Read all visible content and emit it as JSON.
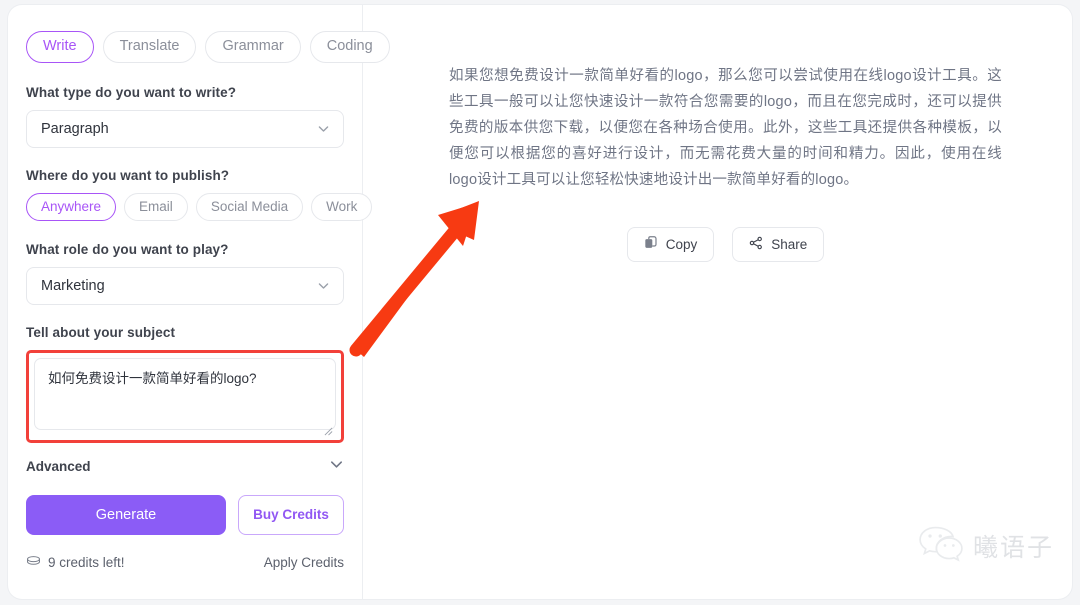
{
  "left": {
    "tabs": [
      {
        "label": "Write",
        "active": true
      },
      {
        "label": "Translate",
        "active": false
      },
      {
        "label": "Grammar",
        "active": false
      },
      {
        "label": "Coding",
        "active": false
      }
    ],
    "type_label": "What type do you want to write?",
    "type_value": "Paragraph",
    "publish_label": "Where do you want to publish?",
    "publish_options": [
      {
        "label": "Anywhere",
        "active": true
      },
      {
        "label": "Email",
        "active": false
      },
      {
        "label": "Social Media",
        "active": false
      },
      {
        "label": "Work",
        "active": false
      }
    ],
    "role_label": "What role do you want to play?",
    "role_value": "Marketing",
    "subject_label": "Tell about your subject",
    "subject_value": "如何免费设计一款简单好看的logo?",
    "subject_placeholder": "Tell about your subject",
    "advanced_label": "Advanced",
    "generate_label": "Generate",
    "buy_credits_label": "Buy Credits",
    "credits_left_label": "9 credits left!",
    "apply_credits_label": "Apply Credits"
  },
  "right": {
    "result_text": "如果您想免费设计一款简单好看的logo，那么您可以尝试使用在线logo设计工具。这些工具一般可以让您快速设计一款符合您需要的logo，而且在您完成时，还可以提供免费的版本供您下载，以便您在各种场合使用。此外，这些工具还提供各种模板，以便您可以根据您的喜好进行设计，而无需花费大量的时间和精力。因此，使用在线logo设计工具可以让您轻松快速地设计出一款简单好看的logo。",
    "copy_label": "Copy",
    "share_label": "Share"
  },
  "watermark": {
    "text": "曦语子"
  },
  "colors": {
    "accent_purple": "#a855f7",
    "generate_purple": "#8b5cf6",
    "annotation_red": "#f2403a",
    "body_text": "#6f7585"
  }
}
